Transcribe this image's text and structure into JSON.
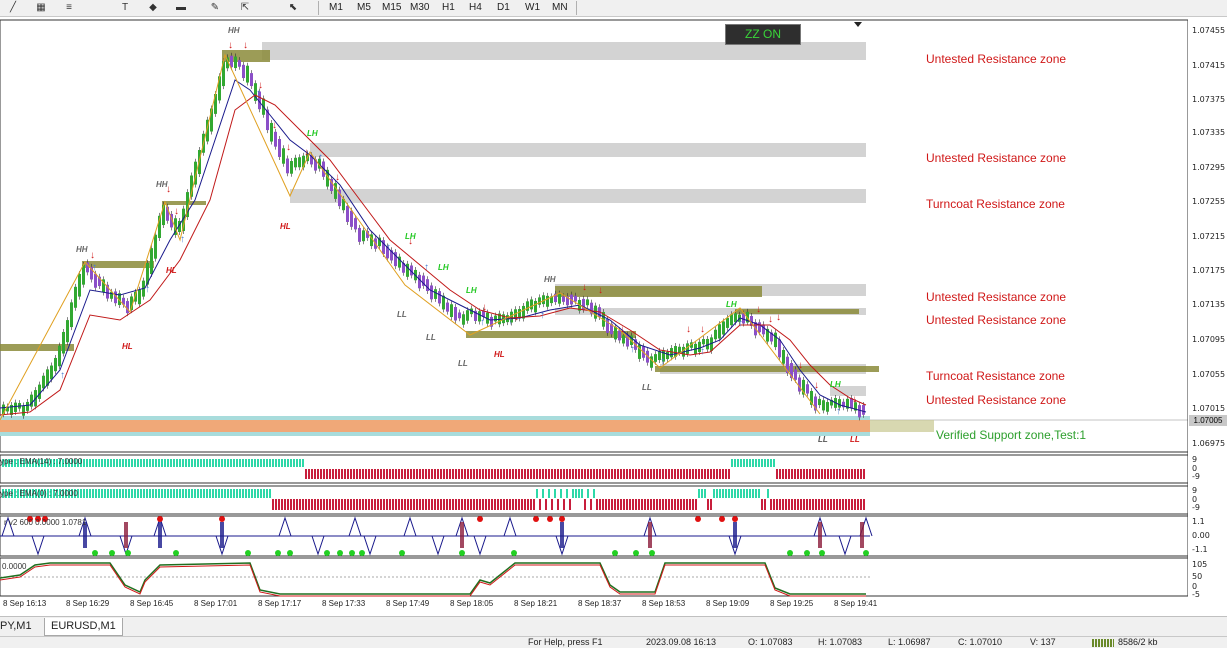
{
  "toolbar": {
    "icons": [
      "line-tool-icon",
      "channel-tool-icon",
      "fibonacci-tool-icon",
      "text-tool-icon",
      "arrow-shape-icon",
      "rectangle-shape-icon",
      "pen-tool-icon",
      "arrow-marker-icon",
      "cursor-menu-icon"
    ],
    "timeframes": [
      "M1",
      "M5",
      "M15",
      "M30",
      "H1",
      "H4",
      "D1",
      "W1",
      "MN"
    ]
  },
  "chart": {
    "zz_button": "ZZ ON",
    "price_axis": [
      "1.07455",
      "1.07415",
      "1.07375",
      "1.07335",
      "1.07295",
      "1.07255",
      "1.07215",
      "1.07175",
      "1.07135",
      "1.07095",
      "1.07055",
      "1.07015",
      "1.06975"
    ],
    "current_price": "1.07005",
    "time_axis": [
      "8 Sep 16:13",
      "8 Sep 16:29",
      "8 Sep 16:45",
      "8 Sep 17:01",
      "8 Sep 17:17",
      "8 Sep 17:33",
      "8 Sep 17:49",
      "8 Sep 18:05",
      "8 Sep 18:21",
      "8 Sep 18:37",
      "8 Sep 18:53",
      "8 Sep 19:09",
      "8 Sep 19:25",
      "8 Sep 19:41"
    ],
    "zone_labels": [
      "Untested Resistance zone",
      "Untested Resistance zone",
      "Turncoat Resistance zone",
      "Untested Resistance zone",
      "Untested Resistance zone",
      "Turncoat Resistance zone",
      "Untested Resistance zone"
    ],
    "support_label": "Verified Support zone,Test:1",
    "swing_labels": [
      "HH",
      "HH",
      "HH",
      "HH",
      "LH",
      "LH",
      "LH",
      "LH",
      "LH",
      "LH",
      "HL",
      "HL",
      "HL",
      "HL",
      "LL",
      "LL",
      "LL",
      "LL",
      "LL",
      "LL"
    ],
    "colors": {
      "resistance_zone": "#d3d3d3",
      "turncoat_zone": "#8b8b3a",
      "support_zone": "#f0a878",
      "support_edge": "#a8dcdc",
      "bull_candle": "#32a832",
      "bear_candle": "#8b4fc8",
      "zone_text": "#d01818",
      "support_text": "#2ea02e",
      "ema_fast": "#1a1a8c",
      "ema_slow": "#c01818",
      "zigzag": "#e0a020"
    }
  },
  "indicators": {
    "ind1_label": "ype : EMA(14) : 7.0000",
    "ind1_scale": [
      "9",
      "0",
      "-9"
    ],
    "ind2_label": "ype : EMA(0) : 7.0000",
    "ind2_scale": [
      "9",
      "0",
      "-9"
    ],
    "ind3_label": "r v2 600 0.0000 1.0781",
    "ind3_scale": [
      "1.1",
      "0.00",
      "-1.1"
    ],
    "ind4_label": "0.0000",
    "ind4_scale": [
      "105",
      "50",
      "0",
      "-5"
    ]
  },
  "tabs": [
    "PY,M1",
    "EURUSD,M1"
  ],
  "status": [
    "For Help, press F1",
    "2023.09.08 16:13",
    "O: 1.07083",
    "H: 1.07083",
    "L: 1.06987",
    "C: 1.07010",
    "V: 137",
    "8586/2 kb"
  ]
}
